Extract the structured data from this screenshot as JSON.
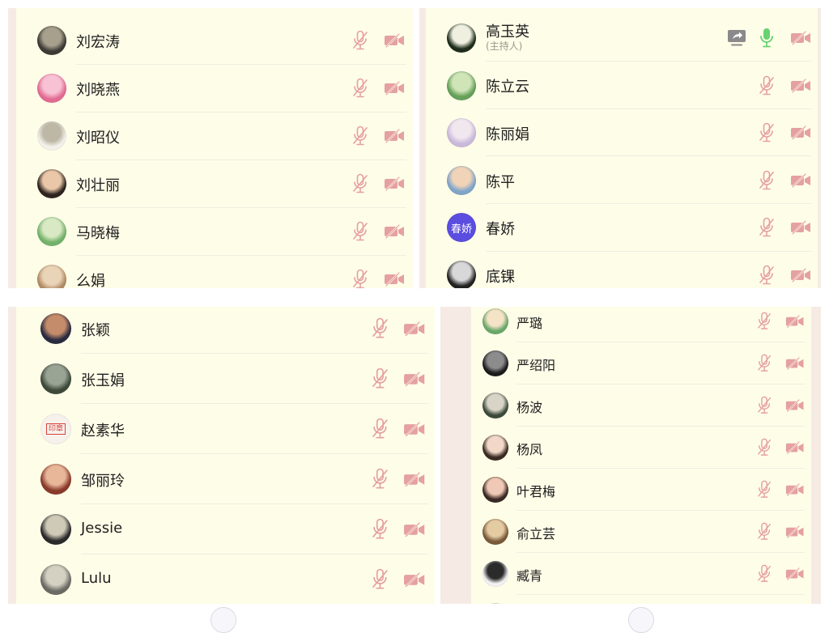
{
  "colors": {
    "list_bg": "#fefde8",
    "muted_icon": "#e5a0a0",
    "speaking_mic": "#66d36e",
    "screen_share": "#8a8a8a",
    "badge_purple": "#5b4de0"
  },
  "panels": [
    {
      "participants": [
        {
          "name": "刘宏涛",
          "mic": "muted",
          "camera": "off",
          "avatar": {
            "colors": [
              "#3d3a34",
              "#a6a08c"
            ]
          }
        },
        {
          "name": "刘晓燕",
          "mic": "muted",
          "camera": "off",
          "avatar": {
            "colors": [
              "#e36b93",
              "#f7c2d4"
            ]
          }
        },
        {
          "name": "刘昭仪",
          "mic": "muted",
          "camera": "off",
          "avatar": {
            "colors": [
              "#f3f1ea",
              "#bdb7a6"
            ]
          }
        },
        {
          "name": "刘壮丽",
          "mic": "muted",
          "camera": "off",
          "avatar": {
            "colors": [
              "#2d241f",
              "#e9c7a8"
            ]
          }
        },
        {
          "name": "马晓梅",
          "mic": "muted",
          "camera": "off",
          "avatar": {
            "colors": [
              "#73b26a",
              "#d8e9c3"
            ]
          }
        },
        {
          "name": "么娟",
          "mic": "muted",
          "camera": "off",
          "avatar": {
            "colors": [
              "#b08a63",
              "#ead4b8"
            ]
          }
        }
      ]
    },
    {
      "participants": [
        {
          "name": "高玉英",
          "subtitle": "(主持人)",
          "mic": "active",
          "camera": "off",
          "share": true,
          "avatar": {
            "colors": [
              "#1e2d1b",
              "#f0f0e0"
            ]
          }
        },
        {
          "name": "陈立云",
          "mic": "muted",
          "camera": "off",
          "avatar": {
            "colors": [
              "#66a05a",
              "#cfe5b8"
            ]
          }
        },
        {
          "name": "陈丽娟",
          "mic": "muted",
          "camera": "off",
          "avatar": {
            "colors": [
              "#c9b9da",
              "#f1e7ee"
            ]
          }
        },
        {
          "name": "陈平",
          "mic": "muted",
          "camera": "off",
          "avatar": {
            "colors": [
              "#7fa6c9",
              "#f1d3b8"
            ]
          }
        },
        {
          "name": "春娇",
          "mic": "muted",
          "camera": "off",
          "avatar": {
            "text": "春娇",
            "colors": [
              "#5b4de0",
              "#5b4de0"
            ]
          }
        },
        {
          "name": "底锞",
          "mic": "muted",
          "camera": "off",
          "avatar": {
            "colors": [
              "#222222",
              "#d8d8d8"
            ]
          }
        }
      ]
    },
    {
      "participants": [
        {
          "name": "张颖",
          "mic": "muted",
          "camera": "off",
          "avatar": {
            "colors": [
              "#2a2b40",
              "#c48c6a"
            ]
          }
        },
        {
          "name": "张玉娟",
          "mic": "muted",
          "camera": "off",
          "avatar": {
            "colors": [
              "#3d4a3a",
              "#9aa495"
            ]
          }
        },
        {
          "name": "赵素华",
          "mic": "muted",
          "camera": "off",
          "avatar": {
            "text": "印章",
            "colors": [
              "#f7f1ec",
              "#d9413a"
            ]
          }
        },
        {
          "name": "邹丽玲",
          "mic": "muted",
          "camera": "off",
          "avatar": {
            "colors": [
              "#8a3a2a",
              "#e8b79a"
            ]
          }
        },
        {
          "name": "Jessie",
          "mic": "muted",
          "camera": "off",
          "avatar": {
            "colors": [
              "#2a2a2a",
              "#cfcab8"
            ]
          }
        },
        {
          "name": "Lulu",
          "mic": "muted",
          "camera": "off",
          "avatar": {
            "colors": [
              "#6b6a64",
              "#d4d0c2"
            ]
          }
        }
      ]
    },
    {
      "participants": [
        {
          "name": "严璐",
          "mic": "muted",
          "camera": "off",
          "avatar": {
            "colors": [
              "#6aa86a",
              "#f4e3c6"
            ]
          }
        },
        {
          "name": "严绍阳",
          "mic": "muted",
          "camera": "off",
          "avatar": {
            "colors": [
              "#1c1c1c",
              "#8c8c8c"
            ]
          }
        },
        {
          "name": "杨波",
          "mic": "muted",
          "camera": "off",
          "avatar": {
            "colors": [
              "#3c4a3a",
              "#d8d4c8"
            ]
          }
        },
        {
          "name": "杨凤",
          "mic": "muted",
          "camera": "off",
          "avatar": {
            "colors": [
              "#3a2a22",
              "#f1d8c8"
            ]
          }
        },
        {
          "name": "叶君梅",
          "mic": "muted",
          "camera": "off",
          "avatar": {
            "colors": [
              "#3a2822",
              "#efc9b6"
            ]
          }
        },
        {
          "name": "俞立芸",
          "mic": "muted",
          "camera": "off",
          "avatar": {
            "colors": [
              "#7a5a3a",
              "#e4cba2"
            ]
          }
        },
        {
          "name": "臧青",
          "mic": "muted",
          "camera": "off",
          "avatar": {
            "colors": [
              "#f2f2f2",
              "#2b2b2b"
            ]
          }
        }
      ]
    }
  ]
}
